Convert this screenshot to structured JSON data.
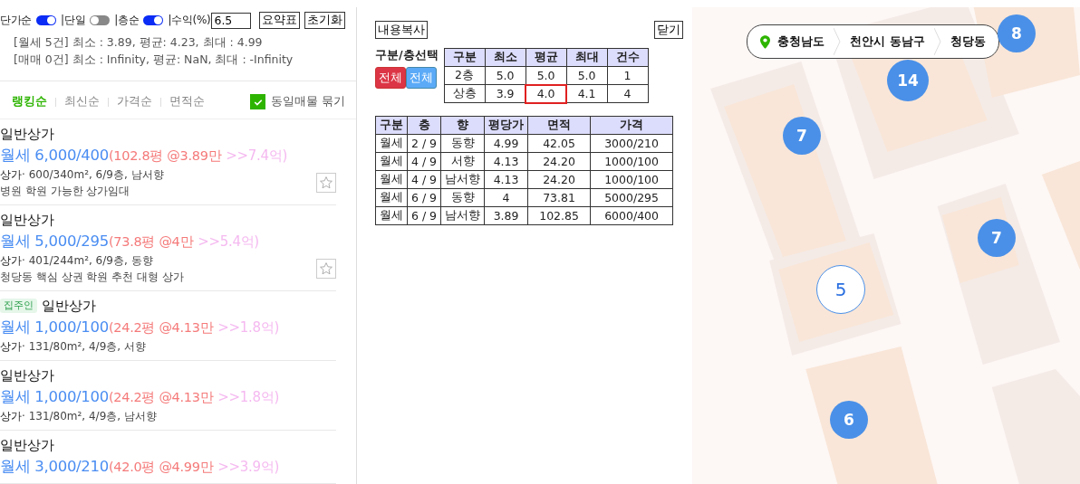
{
  "toolbar": {
    "toggles": [
      {
        "label": "단가순",
        "on": true
      },
      {
        "label": "|단일",
        "on": false
      },
      {
        "label": "|층순",
        "on": true
      }
    ],
    "yield": {
      "label": "|수익(%)",
      "value": "6.5"
    },
    "buttons": [
      "요약표",
      "초기화"
    ]
  },
  "stats": [
    "[월세 5건] 최소 : 3.89, 평균: 4.23, 최대 : 4.99",
    "[매매 0건] 최소 : Infinity, 평균: NaN, 최대 : -Infinity"
  ],
  "sort_tabs": [
    {
      "label": "랭킹순",
      "selected": true
    },
    {
      "label": "최신순",
      "selected": false
    },
    {
      "label": "가격순",
      "selected": false
    },
    {
      "label": "면적순",
      "selected": false
    }
  ],
  "group_same": {
    "label": "동일매물 묶기",
    "checked": true
  },
  "listings": [
    {
      "title": "일반상가",
      "price": "월세 6,000/400",
      "detail": "(102.8평 @3.89만",
      "estimate": ">>7.4억)",
      "type": "상가",
      "info": "· 600/340m², 6/9층, 남서향",
      "description": "병원 학원 가능한 상가임대",
      "starred": false
    },
    {
      "title": "일반상가",
      "price": "월세 5,000/295",
      "detail": "(73.8평 @4만",
      "estimate": ">>5.4억)",
      "type": "상가",
      "info": "· 401/244m², 6/9층, 동향",
      "description": "청당동 핵심 상권 학원 추천 대형 상가",
      "starred": false
    },
    {
      "badge": "집주인",
      "title": "일반상가",
      "price": "월세 1,000/100",
      "detail": "(24.2평 @4.13만",
      "estimate": ">>1.8억)",
      "type": "상가",
      "info": "· 131/80m², 4/9층, 서향"
    },
    {
      "title": "일반상가",
      "price": "월세 1,000/100",
      "detail": "(24.2평 @4.13만",
      "estimate": ">>1.8억)",
      "type": "상가",
      "info": "· 131/80m², 4/9층, 남서향"
    },
    {
      "title": "일반상가",
      "price": "월세 3,000/210",
      "detail": "(42.0평 @4.99만",
      "estimate": ">>3.9억)"
    }
  ],
  "summary_panel": {
    "copy_button": "내용복사",
    "close_button": "닫기",
    "floor_select": {
      "label": "구분/층선택",
      "buttons": [
        {
          "label": "전체",
          "color": "#dc3545"
        },
        {
          "label": "전체",
          "color": "#5aaaf7"
        }
      ]
    },
    "summary_table": {
      "columns": [
        "구분",
        "최소",
        "평균",
        "최대",
        "건수"
      ],
      "rows": [
        [
          {
            "text": "2층",
            "highlighted": false
          },
          {
            "text": "5.0",
            "highlighted": false
          },
          {
            "text": "5.0",
            "highlighted": false
          },
          {
            "text": "5.0",
            "highlighted": false
          },
          {
            "text": "1",
            "highlighted": false
          }
        ],
        [
          {
            "text": "상층",
            "highlighted": false
          },
          {
            "text": "3.9",
            "highlighted": false
          },
          {
            "text": "4.0",
            "highlighted": true
          },
          {
            "text": "4.1",
            "highlighted": false
          },
          {
            "text": "4",
            "highlighted": false
          }
        ]
      ]
    },
    "detail_table": {
      "columns": [
        "구분",
        "층",
        "향",
        "평당가",
        "면적",
        "가격"
      ],
      "rows": [
        [
          "월세",
          "2 / 9",
          "동향",
          "4.99",
          "42.05",
          "3000/210"
        ],
        [
          "월세",
          "4 / 9",
          "서향",
          "4.13",
          "24.20",
          "1000/100"
        ],
        [
          "월세",
          "4 / 9",
          "남서향",
          "4.13",
          "24.20",
          "1000/100"
        ],
        [
          "월세",
          "6 / 9",
          "동향",
          "4",
          "73.81",
          "5000/295"
        ],
        [
          "월세",
          "6 / 9",
          "남서향",
          "3.89",
          "102.85",
          "6000/400"
        ]
      ]
    }
  },
  "map": {
    "breadcrumb": [
      "충청남도",
      "천안시 동남구",
      "청당동"
    ],
    "clusters": [
      {
        "count": "8",
        "selected": false
      },
      {
        "count": "14",
        "selected": false
      },
      {
        "count": "7",
        "selected": false
      },
      {
        "count": "7",
        "selected": false
      },
      {
        "count": "5",
        "selected": true
      },
      {
        "count": "6",
        "selected": false
      }
    ]
  }
}
